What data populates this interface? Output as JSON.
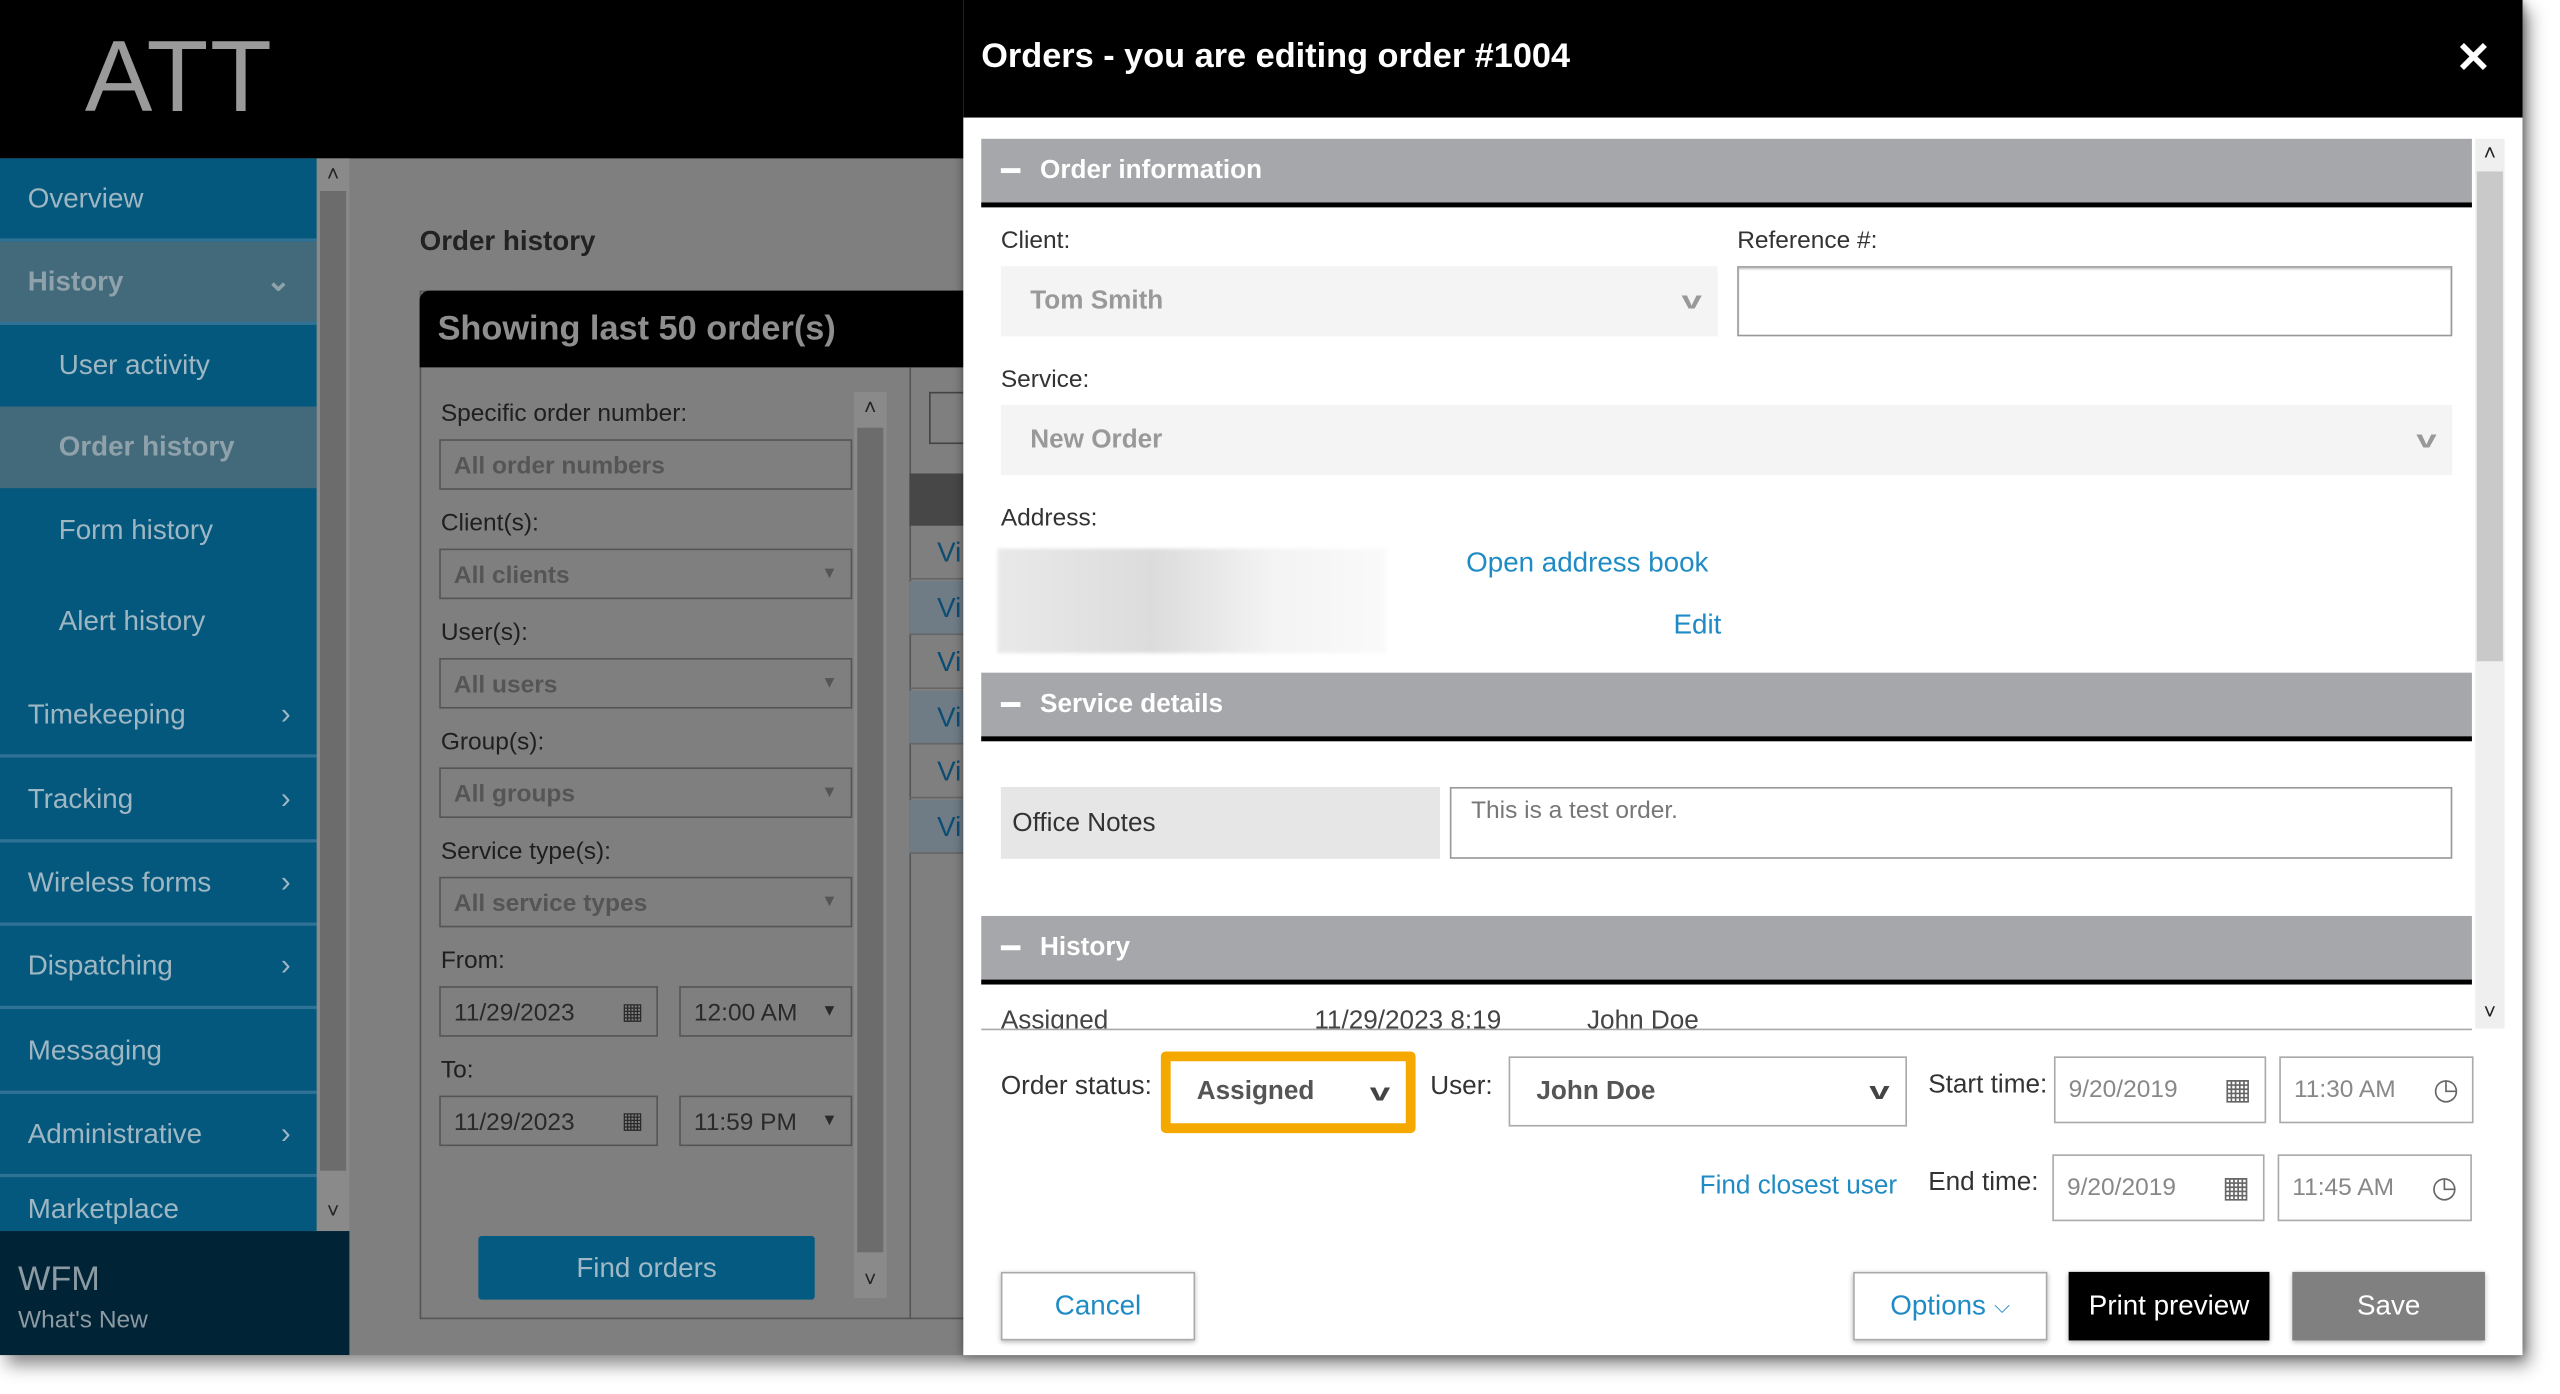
{
  "app": {
    "logo": "ATT",
    "footer_title": "WFM",
    "footer_link": "What's New"
  },
  "sidebar": {
    "items": [
      {
        "label": "Overview",
        "chevron": ""
      },
      {
        "label": "History",
        "chevron": "⌄"
      },
      {
        "label": "User activity",
        "chevron": ""
      },
      {
        "label": "Order history",
        "chevron": ""
      },
      {
        "label": "Form history",
        "chevron": ""
      },
      {
        "label": "Alert history",
        "chevron": ""
      },
      {
        "label": "Timekeeping",
        "chevron": "›"
      },
      {
        "label": "Tracking",
        "chevron": "›"
      },
      {
        "label": "Wireless forms",
        "chevron": "›"
      },
      {
        "label": "Dispatching",
        "chevron": "›"
      },
      {
        "label": "Messaging",
        "chevron": ""
      },
      {
        "label": "Administrative",
        "chevron": "›"
      },
      {
        "label": "Marketplace",
        "chevron": ""
      }
    ]
  },
  "order_history": {
    "title": "Order history",
    "panel_title": "Showing last 50 order(s)",
    "filters": {
      "order_number_label": "Specific order number:",
      "order_number_placeholder": "All order numbers",
      "clients_label": "Client(s):",
      "clients_value": "All clients",
      "users_label": "User(s):",
      "users_value": "All users",
      "groups_label": "Group(s):",
      "groups_value": "All groups",
      "service_types_label": "Service type(s):",
      "service_types_value": "All service types",
      "from_label": "From:",
      "from_date": "11/29/2023",
      "from_time": "12:00 AM",
      "to_label": "To:",
      "to_date": "11/29/2023",
      "to_time": "11:59 PM"
    },
    "find_button": "Find orders",
    "rows": [
      "Vi",
      "Vi",
      "Vi",
      "Vi",
      "Vi",
      "Vi"
    ]
  },
  "modal": {
    "title": "Orders - you are editing order #1004",
    "close": "✕",
    "sections": {
      "order_info": "Order information",
      "service_details": "Service details",
      "history": "History"
    },
    "client_label": "Client:",
    "client_value": "Tom Smith",
    "reference_label": "Reference #:",
    "reference_value": "",
    "service_label": "Service:",
    "service_value": "New Order",
    "address_label": "Address:",
    "open_address_book": "Open address book",
    "edit": "Edit",
    "office_notes_label": "Office Notes",
    "office_notes_value": "This is a test order.",
    "history_row": {
      "status": "Assigned",
      "datetime": "11/29/2023 8:19",
      "user": "John Doe"
    },
    "order_status_label": "Order status:",
    "order_status_value": "Assigned",
    "user_label": "User:",
    "user_value": "John Doe",
    "find_closest_user": "Find closest user",
    "start_label": "Start time:",
    "start_date": "9/20/2019",
    "start_time": "11:30 AM",
    "end_label": "End time:",
    "end_date": "9/20/2019",
    "end_time": "11:45 AM",
    "buttons": {
      "cancel": "Cancel",
      "options": "Options",
      "print_preview": "Print preview",
      "save": "Save"
    }
  },
  "colors": {
    "highlight": "#f5a800",
    "link": "#1f8bc4",
    "sidebar": "#04587d"
  }
}
